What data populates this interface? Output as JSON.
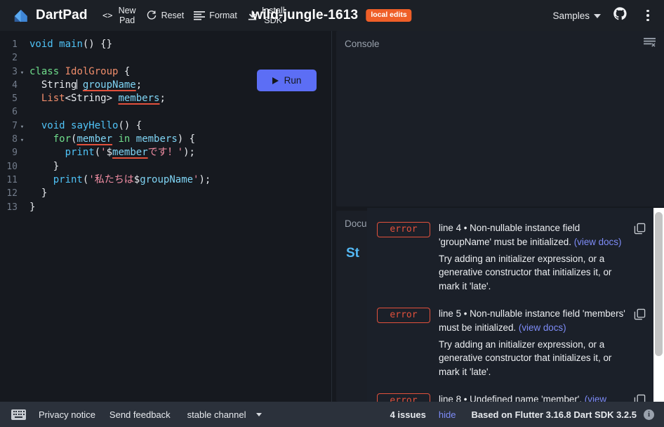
{
  "header": {
    "brand": "DartPad",
    "logo_icon": "dart-logo-icon",
    "actions": [
      {
        "label": "New\nPad",
        "icon": "code-brackets-icon"
      },
      {
        "label": "Reset",
        "icon": "refresh-icon"
      },
      {
        "label": "Format",
        "icon": "format-lines-icon"
      },
      {
        "label": "Install\nSDK",
        "icon": "download-icon"
      }
    ],
    "pad_name": "wild-jungle-1613",
    "local_edits_badge": "local edits",
    "samples_label": "Samples",
    "github_icon": "github-icon",
    "overflow_icon": "kebab-menu-icon",
    "accent_orange": "#ef5f28"
  },
  "editor": {
    "run_label": "Run",
    "run_icon": "play-triangle-icon",
    "run_color": "#5c6ef5",
    "lines": [
      {
        "n": "1",
        "fold": "",
        "html": "<span class='t-kw'>void</span> <span class='t-fn'>main</span><span class='t-punc'>() {}</span>"
      },
      {
        "n": "2",
        "fold": "",
        "html": ""
      },
      {
        "n": "3",
        "fold": "▾",
        "html": "<span class='t-green'>class</span> <span class='t-type'>IdolGroup</span> <span class='t-punc'>{</span>"
      },
      {
        "n": "4",
        "fold": "",
        "html": "  <span class='t-plain'>String</span><span class='caret'></span> <span class='t-id squig'>groupName</span><span class='t-punc'>;</span>"
      },
      {
        "n": "5",
        "fold": "",
        "html": "  <span class='t-type'>List</span><span class='t-plain'>&lt;String&gt;</span> <span class='t-id squig'>members</span><span class='t-punc'>;</span>"
      },
      {
        "n": "6",
        "fold": "",
        "html": ""
      },
      {
        "n": "7",
        "fold": "▾",
        "html": "  <span class='t-kw'>void</span> <span class='t-fn'>sayHello</span><span class='t-punc'>() {</span>"
      },
      {
        "n": "8",
        "fold": "▾",
        "html": "    <span class='t-green'>for</span><span class='t-punc'>(</span><span class='t-id squig'>member</span> <span class='t-green'>in</span> <span class='t-id'>members</span><span class='t-punc'>) {</span>"
      },
      {
        "n": "9",
        "fold": "",
        "html": "      <span class='t-fn'>print</span><span class='t-punc'>(</span><span class='t-str'>'</span><span class='t-plain'>$</span><span class='t-id squig'>member</span><span class='t-str'>です！</span><span class='t-str'>'</span><span class='t-punc'>);</span>"
      },
      {
        "n": "10",
        "fold": "",
        "html": "    <span class='t-punc'>}</span>"
      },
      {
        "n": "11",
        "fold": "",
        "html": "    <span class='t-fn'>print</span><span class='t-punc'>(</span><span class='t-str'>'私たちは</span><span class='t-plain'>$</span><span class='t-id'>groupName</span><span class='t-str'>'</span><span class='t-punc'>);</span>"
      },
      {
        "n": "12",
        "fold": "",
        "html": "  <span class='t-punc'>}</span>"
      },
      {
        "n": "13",
        "fold": "",
        "html": "<span class='t-punc'>}</span>"
      }
    ]
  },
  "console_panel": {
    "title": "Console",
    "clear_icon": "clear-console-icon",
    "output": ""
  },
  "docs_panel": {
    "title": "Docum",
    "type_name": "St"
  },
  "issues": {
    "list": [
      {
        "severity": "error",
        "location": "line 4",
        "message": "Non-nullable instance field 'groupName' must be initialized.",
        "docs_link": "(view docs)",
        "fix": "Try adding an initializer expression, or a generative constructor that initializes it, or mark it 'late'.",
        "copy_icon": "copy-icon"
      },
      {
        "severity": "error",
        "location": "line 5",
        "message": "Non-nullable instance field 'members' must be initialized.",
        "docs_link": "(view docs)",
        "fix": "Try adding an initializer expression, or a generative constructor that initializes it, or mark it 'late'.",
        "copy_icon": "copy-icon"
      },
      {
        "severity": "error",
        "location": "line 8",
        "message": "Undefined name 'member'.",
        "docs_link": "(view docs)",
        "fix": "",
        "copy_icon": "copy-icon"
      }
    ],
    "separator": "•",
    "error_color": "#e2513c",
    "link_color": "#7e8cf8"
  },
  "footer": {
    "keyboard_icon": "keyboard-icon",
    "privacy_label": "Privacy notice",
    "feedback_label": "Send feedback",
    "channel_label": "stable channel",
    "channel_chevron_icon": "chevron-down-icon",
    "issues_count": "4 issues",
    "hide_label": "hide",
    "sdk_info": "Based on Flutter 3.16.8 Dart SDK 3.2.5",
    "info_icon": "info-icon"
  }
}
